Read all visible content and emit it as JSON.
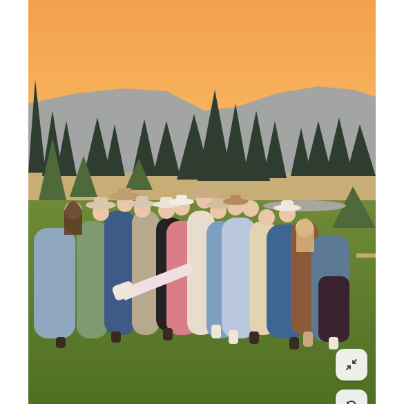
{
  "viewer": {
    "photo_alt": "",
    "controls": [
      {
        "icon": "collapse-arrows-icon"
      },
      {
        "icon": "rotate-icon"
      }
    ]
  },
  "colors": {
    "sky_top": "#f4a24f",
    "sky_mid": "#f6b560",
    "mountain": "#9fa7ad",
    "forest": "#3b4a3c",
    "meadow": "#cdb27a",
    "grass": "#5b7a2c"
  }
}
